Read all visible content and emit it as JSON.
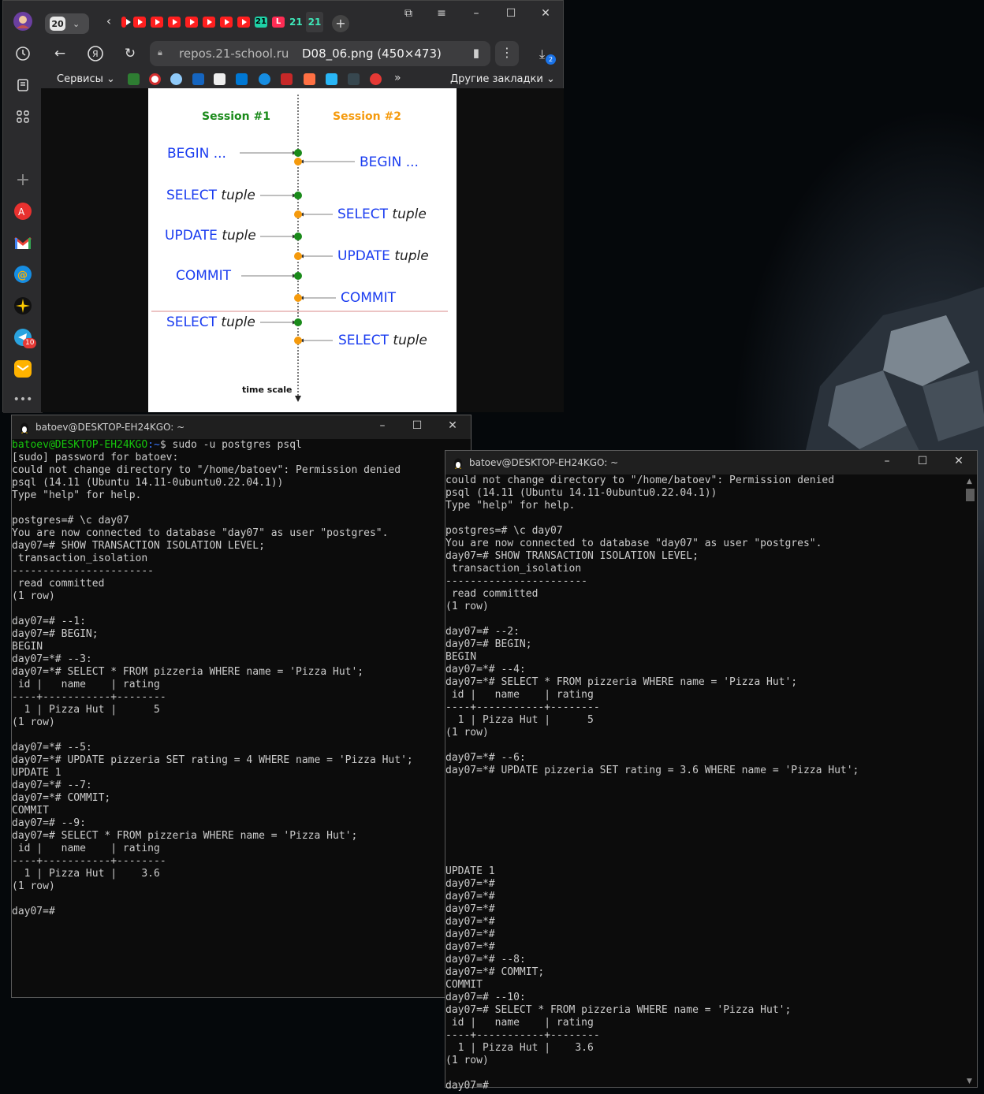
{
  "browser": {
    "tab_count": "20",
    "address": {
      "domain": "repos.21-school.ru",
      "title": "D08_06.png (450×473)"
    },
    "download_badge": "2",
    "bookmarks": {
      "services_label": "Сервисы",
      "other_label": "Другие закладки",
      "more_label": "»"
    },
    "sidebar_badge": "10",
    "tab_favicons": [
      "youtube",
      "youtube",
      "youtube",
      "youtube",
      "youtube",
      "youtube",
      "youtube",
      "school21",
      "lms",
      "school21",
      "school21"
    ],
    "colors": {
      "chrome": "#2b2b2d",
      "address_bg": "#3d3d3f"
    }
  },
  "diagram": {
    "session1": "Session #1",
    "session2": "Session #2",
    "s1_steps": [
      {
        "cmd": "BEGIN ...",
        "obj": ""
      },
      {
        "cmd": "SELECT",
        "obj": "tuple"
      },
      {
        "cmd": "UPDATE",
        "obj": "tuple"
      },
      {
        "cmd": "COMMIT",
        "obj": ""
      },
      {
        "cmd": "SELECT",
        "obj": "tuple"
      }
    ],
    "s2_steps": [
      {
        "cmd": "BEGIN ...",
        "obj": ""
      },
      {
        "cmd": "SELECT",
        "obj": "tuple"
      },
      {
        "cmd": "UPDATE",
        "obj": "tuple"
      },
      {
        "cmd": "COMMIT",
        "obj": ""
      },
      {
        "cmd": "SELECT",
        "obj": "tuple"
      }
    ],
    "time_scale": "time scale",
    "colors": {
      "session1": "#1a8a1a",
      "session2": "#f59a0c",
      "command": "#1a3cf0",
      "divider": "#d98a8a"
    }
  },
  "terminal1": {
    "title": "batoev@DESKTOP-EH24KGO: ~",
    "prompt_user": "batoev@DESKTOP-EH24KGO",
    "prompt_path": ":~",
    "first_command": "$ sudo -u postgres psql",
    "lines": [
      "[sudo] password for batoev:",
      "could not change directory to \"/home/batoev\": Permission denied",
      "psql (14.11 (Ubuntu 14.11-0ubuntu0.22.04.1))",
      "Type \"help\" for help.",
      "",
      "postgres=# \\c day07",
      "You are now connected to database \"day07\" as user \"postgres\".",
      "day07=# SHOW TRANSACTION ISOLATION LEVEL;",
      " transaction_isolation",
      "-----------------------",
      " read committed",
      "(1 row)",
      "",
      "day07=# --1:",
      "day07=# BEGIN;",
      "BEGIN",
      "day07=*# --3:",
      "day07=*# SELECT * FROM pizzeria WHERE name = 'Pizza Hut';",
      " id |   name    | rating",
      "----+-----------+--------",
      "  1 | Pizza Hut |      5",
      "(1 row)",
      "",
      "day07=*# --5:",
      "day07=*# UPDATE pizzeria SET rating = 4 WHERE name = 'Pizza Hut';",
      "UPDATE 1",
      "day07=*# --7:",
      "day07=*# COMMIT;",
      "COMMIT",
      "day07=# --9:",
      "day07=# SELECT * FROM pizzeria WHERE name = 'Pizza Hut';",
      " id |   name    | rating",
      "----+-----------+--------",
      "  1 | Pizza Hut |    3.6",
      "(1 row)",
      "",
      "day07=#"
    ]
  },
  "terminal2": {
    "title": "batoev@DESKTOP-EH24KGO: ~",
    "lines": [
      "could not change directory to \"/home/batoev\": Permission denied",
      "psql (14.11 (Ubuntu 14.11-0ubuntu0.22.04.1))",
      "Type \"help\" for help.",
      "",
      "postgres=# \\c day07",
      "You are now connected to database \"day07\" as user \"postgres\".",
      "day07=# SHOW TRANSACTION ISOLATION LEVEL;",
      " transaction_isolation",
      "-----------------------",
      " read committed",
      "(1 row)",
      "",
      "day07=# --2:",
      "day07=# BEGIN;",
      "BEGIN",
      "day07=*# --4:",
      "day07=*# SELECT * FROM pizzeria WHERE name = 'Pizza Hut';",
      " id |   name    | rating",
      "----+-----------+--------",
      "  1 | Pizza Hut |      5",
      "(1 row)",
      "",
      "day07=*# --6:",
      "day07=*# UPDATE pizzeria SET rating = 3.6 WHERE name = 'Pizza Hut';",
      "",
      "",
      "",
      "",
      "",
      "",
      "",
      "UPDATE 1",
      "day07=*#",
      "day07=*#",
      "day07=*#",
      "day07=*#",
      "day07=*#",
      "day07=*#",
      "day07=*# --8:",
      "day07=*# COMMIT;",
      "COMMIT",
      "day07=# --10:",
      "day07=# SELECT * FROM pizzeria WHERE name = 'Pizza Hut';",
      " id |   name    | rating",
      "----+-----------+--------",
      "  1 | Pizza Hut |    3.6",
      "(1 row)",
      "",
      "day07=#"
    ]
  },
  "terminal_colors": {
    "bg": "#0c0c0c",
    "text": "#cccccc",
    "prompt_user": "#16c60c",
    "prompt_path": "#3b78ff"
  }
}
